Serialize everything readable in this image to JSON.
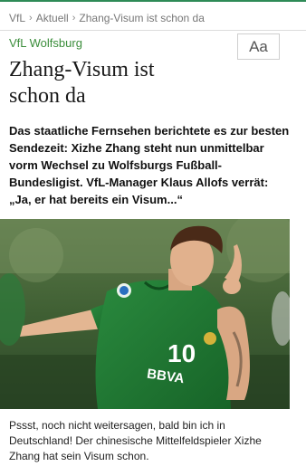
{
  "breadcrumb": {
    "items": [
      "VfL",
      "Aktuell",
      "Zhang-Visum ist schon da"
    ],
    "separator": "›"
  },
  "section": "VfL Wolfsburg",
  "font_button": "Aa",
  "article": {
    "headline_line1": "Zhang-Visum ist",
    "headline_line2": "schon da",
    "lead": "Das staatliche Fernsehen berichtete es zur besten Sendezeit: Xizhe Zhang steht nun unmittelbar vorm Wechsel zu Wolfsburgs Fußball-Bundesligist. VfL-Manager Klaus Allofs verrät: „Ja, er hat bereits ein Visum...“",
    "caption": "Pssst, noch nicht weitersagen, bald bin ich in Deutschland! Der chinesische Mittelfeldspieler Xizhe Zhang hat sein Visum schon."
  },
  "photo": {
    "jersey_number": "10",
    "sponsor": "BBVA"
  },
  "colors": {
    "accent_green": "#3a8d3a",
    "top_rule": "#2e8b57",
    "jersey_green": "#1f7a34"
  },
  "icons": [
    "chevron-right-icon"
  ]
}
